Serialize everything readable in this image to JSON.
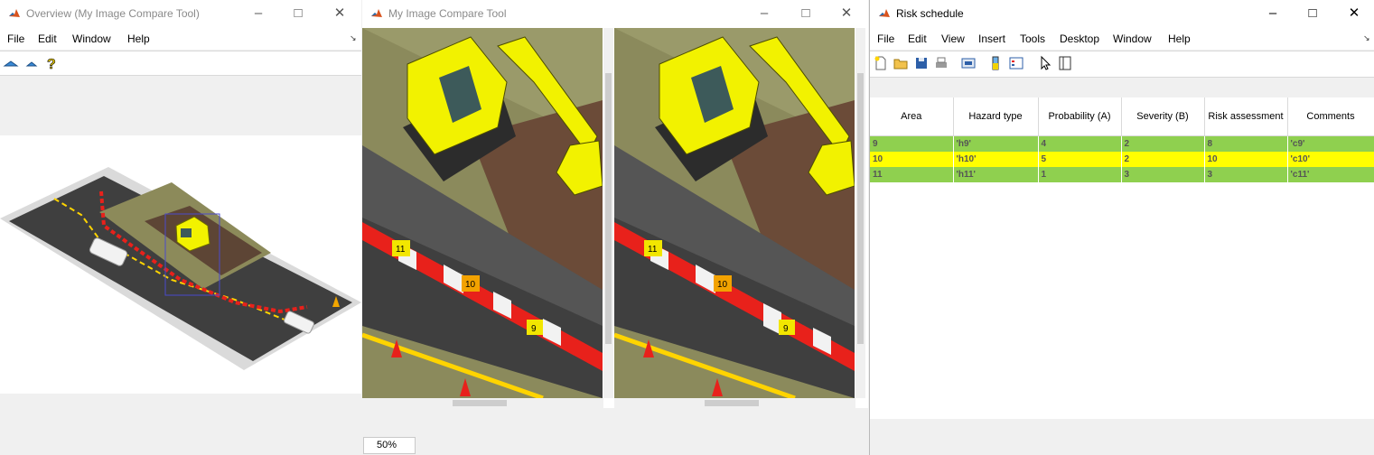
{
  "overview": {
    "title": "Overview (My Image Compare Tool)",
    "menu": [
      "File",
      "Edit",
      "Window",
      "Help"
    ]
  },
  "compare": {
    "title": "My Image Compare Tool",
    "zoom": "50%",
    "markers": [
      "11",
      "10",
      "9"
    ]
  },
  "risk": {
    "title": "Risk schedule",
    "menu": [
      "File",
      "Edit",
      "View",
      "Insert",
      "Tools",
      "Desktop",
      "Window",
      "Help"
    ],
    "columns": [
      "Area",
      "Hazard type",
      "Probability (A)",
      "Severity (B)",
      "Risk assessment",
      "Comments"
    ],
    "rows": [
      {
        "area": "9",
        "hazard": "'h9'",
        "prob": "4",
        "sev": "2",
        "risk": "8",
        "comment": "'c9'",
        "color": "#8fd04f"
      },
      {
        "area": "10",
        "hazard": "'h10'",
        "prob": "5",
        "sev": "2",
        "risk": "10",
        "comment": "'c10'",
        "color": "#ffff00"
      },
      {
        "area": "11",
        "hazard": "'h11'",
        "prob": "1",
        "sev": "3",
        "risk": "3",
        "comment": "'c11'",
        "color": "#8fd04f"
      }
    ]
  },
  "colors": {
    "excavator": "#f2f200",
    "barrier_red": "#e8211b",
    "road": "#3f3f3f",
    "line_yellow": "#ffd400"
  }
}
